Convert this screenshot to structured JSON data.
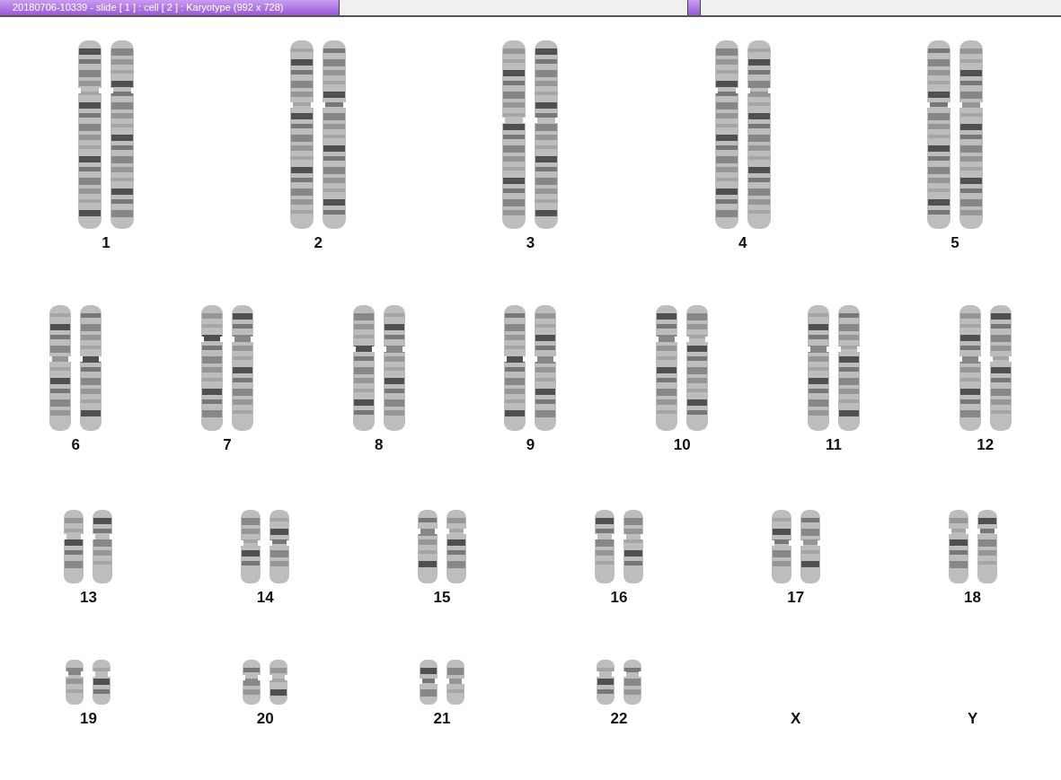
{
  "window": {
    "title": "20180706-10339 - slide [ 1 ] : cell [ 2 ] : Karyotype  (992 x 728)"
  },
  "karyotype": {
    "rows": [
      {
        "kind": "large",
        "items": [
          {
            "label": "1",
            "kind": "pair"
          },
          {
            "label": "2",
            "kind": "pair"
          },
          {
            "label": "3",
            "kind": "pair"
          },
          {
            "label": "4",
            "kind": "pair"
          },
          {
            "label": "5",
            "kind": "pair"
          }
        ]
      },
      {
        "kind": "medium",
        "items": [
          {
            "label": "6",
            "kind": "pair"
          },
          {
            "label": "7",
            "kind": "pair"
          },
          {
            "label": "8",
            "kind": "pair"
          },
          {
            "label": "9",
            "kind": "pair"
          },
          {
            "label": "10",
            "kind": "pair"
          },
          {
            "label": "11",
            "kind": "pair"
          },
          {
            "label": "12",
            "kind": "pair"
          }
        ]
      },
      {
        "kind": "small",
        "items": [
          {
            "label": "13",
            "kind": "pair"
          },
          {
            "label": "14",
            "kind": "pair"
          },
          {
            "label": "15",
            "kind": "pair"
          },
          {
            "label": "16",
            "kind": "pair"
          },
          {
            "label": "17",
            "kind": "pair"
          },
          {
            "label": "18",
            "kind": "pair"
          }
        ]
      },
      {
        "kind": "tiny",
        "items": [
          {
            "label": "19",
            "kind": "pair"
          },
          {
            "label": "20",
            "kind": "pair"
          },
          {
            "label": "21",
            "kind": "pair"
          },
          {
            "label": "22",
            "kind": "pair"
          },
          {
            "label": "X",
            "kind": "empty"
          },
          {
            "label": "Y",
            "kind": "empty"
          }
        ]
      }
    ]
  }
}
